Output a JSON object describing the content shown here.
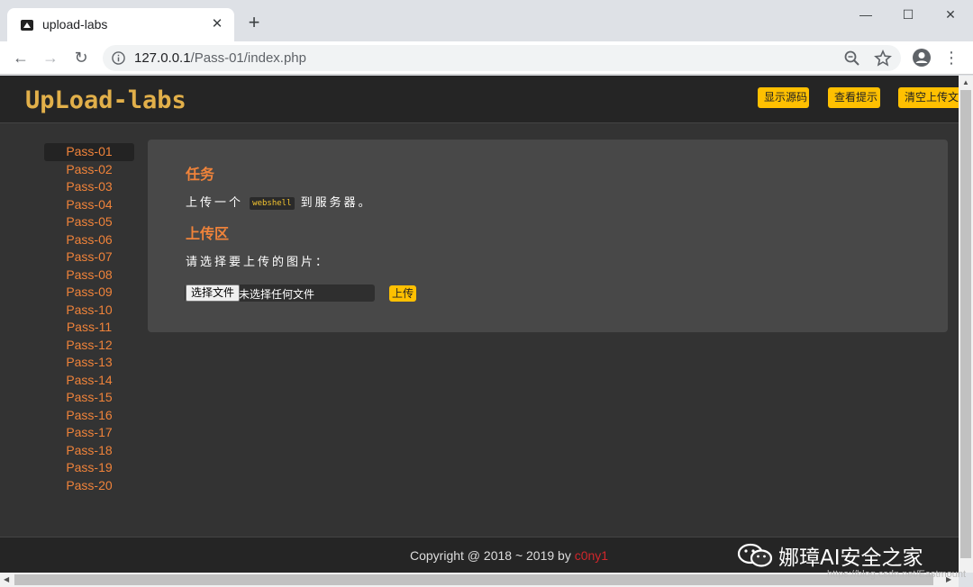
{
  "browser": {
    "tab_title": "upload-labs",
    "url_host": "127.0.0.1",
    "url_path": "/Pass-01/index.php"
  },
  "header": {
    "logo_text": "UpLoad-labs",
    "buttons": {
      "show_source": "显示源码",
      "view_hint": "查看提示",
      "clear_uploads": "清空上传文件"
    }
  },
  "sidebar": {
    "items": [
      "Pass-01",
      "Pass-02",
      "Pass-03",
      "Pass-04",
      "Pass-05",
      "Pass-06",
      "Pass-07",
      "Pass-08",
      "Pass-09",
      "Pass-10",
      "Pass-11",
      "Pass-12",
      "Pass-13",
      "Pass-14",
      "Pass-15",
      "Pass-16",
      "Pass-17",
      "Pass-18",
      "Pass-19",
      "Pass-20"
    ],
    "active": "Pass-01"
  },
  "main": {
    "task_heading": "任务",
    "task_prefix": "上传一个",
    "task_code": "webshell",
    "task_suffix": "到服务器。",
    "upload_heading": "上传区",
    "upload_prompt": "请选择要上传的图片：",
    "choose_file_label": "选择文件",
    "file_status": "未选择任何文件",
    "submit_label": "上传"
  },
  "footer": {
    "copyright_prefix": "Copyright @ 2018 ~ 2019 by ",
    "author": "c0ny1",
    "watermark": "娜璋AI安全之家"
  },
  "csdn_watermark": "https://blog.csdn.net/Eastmount",
  "colors": {
    "accent_orange": "#f0833a",
    "button_yellow": "#ffc001",
    "author_red": "#d0262b",
    "page_bg": "#333333"
  }
}
